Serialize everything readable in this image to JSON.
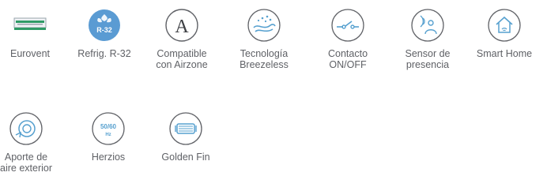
{
  "colors": {
    "icon_stroke": "#56a0cf",
    "badge_fill": "#5a9bd3",
    "label_text": "#5f6166",
    "eurovent_green": "#2f9a66",
    "eurovent_gray": "#9aa4ad"
  },
  "features": [
    {
      "icon": "eurovent-icon",
      "label_lines": [
        "Eurovent"
      ],
      "badge_text": ""
    },
    {
      "icon": "refrigerant-r32-icon",
      "label_lines": [
        "Refrig. R-32"
      ],
      "badge_text": "R-32"
    },
    {
      "icon": "airzone-icon",
      "label_lines": [
        "Compatible",
        "con Airzone"
      ],
      "badge_text": "A"
    },
    {
      "icon": "breezeless-icon",
      "label_lines": [
        "Tecnología",
        "Breezeless"
      ],
      "badge_text": ""
    },
    {
      "icon": "on-off-contact-icon",
      "label_lines": [
        "Contacto",
        "ON/OFF"
      ],
      "badge_text": ""
    },
    {
      "icon": "presence-sensor-icon",
      "label_lines": [
        "Sensor de",
        "presencia"
      ],
      "badge_text": ""
    },
    {
      "icon": "smart-home-icon",
      "label_lines": [
        "Smart Home"
      ],
      "badge_text": ""
    },
    {
      "icon": "fresh-air-icon",
      "label_lines": [
        "Aporte de",
        "aire exterior"
      ],
      "badge_text": ""
    },
    {
      "icon": "hertz-icon",
      "label_lines": [
        "Herzios"
      ],
      "badge_text": "50/60",
      "badge_sub": "Hz"
    },
    {
      "icon": "golden-fin-icon",
      "label_lines": [
        "Golden Fin"
      ],
      "badge_text": ""
    }
  ]
}
